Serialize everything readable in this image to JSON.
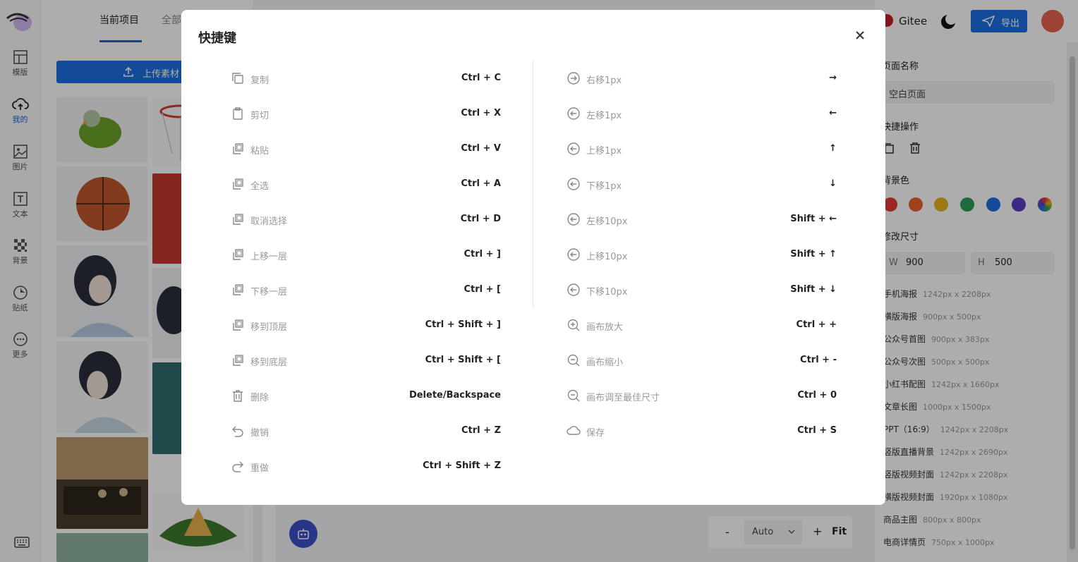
{
  "nav": {
    "items": [
      {
        "label": "模版",
        "icon": "template-icon"
      },
      {
        "label": "我的",
        "icon": "cloud-upload-icon"
      },
      {
        "label": "图片",
        "icon": "image-icon"
      },
      {
        "label": "文本",
        "icon": "text-icon"
      },
      {
        "label": "背景",
        "icon": "checkerboard-icon"
      },
      {
        "label": "贴纸",
        "icon": "sticker-icon"
      },
      {
        "label": "更多",
        "icon": "more-icon"
      }
    ]
  },
  "panel": {
    "tabs": [
      "当前项目",
      "全部"
    ],
    "upload_label": "上传素材"
  },
  "topbar": {
    "gitee_label": "Gitee",
    "export_label": "导出"
  },
  "right_panel": {
    "page_name_title": "页面名称",
    "page_name_value": "空白页面",
    "quick_actions_title": "快捷操作",
    "bg_color_title": "背景色",
    "resize_title": "修改尺寸",
    "width_key": "W",
    "width_value": "900",
    "height_key": "H",
    "height_value": "500",
    "swatches": [
      "#e53935",
      "#e8622c",
      "#e6b422",
      "#2e9d57",
      "#1e6fe0",
      "#5b3cc4",
      "rainbow"
    ],
    "presets": [
      {
        "name": "手机海报",
        "size": "1242px x 2208px"
      },
      {
        "name": "横版海报",
        "size": "900px x 500px"
      },
      {
        "name": "公众号首图",
        "size": "900px x 383px"
      },
      {
        "name": "公众号次图",
        "size": "500px x 500px"
      },
      {
        "name": "小红书配图",
        "size": "1242px x 1660px"
      },
      {
        "name": "文章长图",
        "size": "1000px x 1500px"
      },
      {
        "name": "PPT（16:9）",
        "size": "1242px x 2208px"
      },
      {
        "name": "竖版直播背景",
        "size": "1242px x 2690px"
      },
      {
        "name": "竖版视频封面",
        "size": "1242px x 2208px"
      },
      {
        "name": "横版视频封面",
        "size": "1920px x 1080px"
      },
      {
        "name": "商品主图",
        "size": "800px x 800px"
      },
      {
        "name": "电商详情页",
        "size": "750px x 1000px"
      }
    ]
  },
  "zoom": {
    "minus": "-",
    "value": "Auto",
    "plus": "+",
    "fit": "Fit"
  },
  "modal": {
    "title": "快捷键",
    "left": [
      {
        "label": "复制",
        "key": "Ctrl + C",
        "icon": "copy-icon"
      },
      {
        "label": "剪切",
        "key": "Ctrl + X",
        "icon": "clipboard-icon"
      },
      {
        "label": "粘贴",
        "key": "Ctrl + V",
        "icon": "layers-icon"
      },
      {
        "label": "全选",
        "key": "Ctrl + A",
        "icon": "layers-icon"
      },
      {
        "label": "取消选择",
        "key": "Ctrl + D",
        "icon": "layers-icon"
      },
      {
        "label": "上移一层",
        "key": "Ctrl + ]",
        "icon": "layers-icon"
      },
      {
        "label": "下移一层",
        "key": "Ctrl + [",
        "icon": "layers-icon"
      },
      {
        "label": "移到顶层",
        "key": "Ctrl + Shift + ]",
        "icon": "layers-icon"
      },
      {
        "label": "移到底层",
        "key": "Ctrl + Shift + [",
        "icon": "layers-icon"
      },
      {
        "label": "删除",
        "key": "Delete/Backspace",
        "icon": "trash-icon"
      },
      {
        "label": "撤销",
        "key": "Ctrl + Z",
        "icon": "undo-icon"
      },
      {
        "label": "重做",
        "key": "Ctrl + Shift + Z",
        "icon": "redo-icon"
      }
    ],
    "right": [
      {
        "label": "右移1px",
        "key": "→",
        "icon": "arrow-circle-right-icon"
      },
      {
        "label": "左移1px",
        "key": "←",
        "icon": "arrow-circle-left-icon"
      },
      {
        "label": "上移1px",
        "key": "↑",
        "icon": "arrow-circle-left-icon"
      },
      {
        "label": "下移1px",
        "key": "↓",
        "icon": "arrow-circle-left-icon"
      },
      {
        "label": "左移10px",
        "key": "Shift + ←",
        "icon": "arrow-circle-left-icon"
      },
      {
        "label": "上移10px",
        "key": "Shift + ↑",
        "icon": "arrow-circle-left-icon"
      },
      {
        "label": "下移10px",
        "key": "Shift + ↓",
        "icon": "arrow-circle-left-icon"
      },
      {
        "label": "画布放大",
        "key": "Ctrl + +",
        "icon": "zoom-in-icon"
      },
      {
        "label": "画布缩小",
        "key": "Ctrl + -",
        "icon": "zoom-out-icon"
      },
      {
        "label": "画布调至最佳尺寸",
        "key": "Ctrl + 0",
        "icon": "zoom-out-icon"
      },
      {
        "label": "保存",
        "key": "Ctrl + S",
        "icon": "cloud-save-icon"
      }
    ]
  }
}
